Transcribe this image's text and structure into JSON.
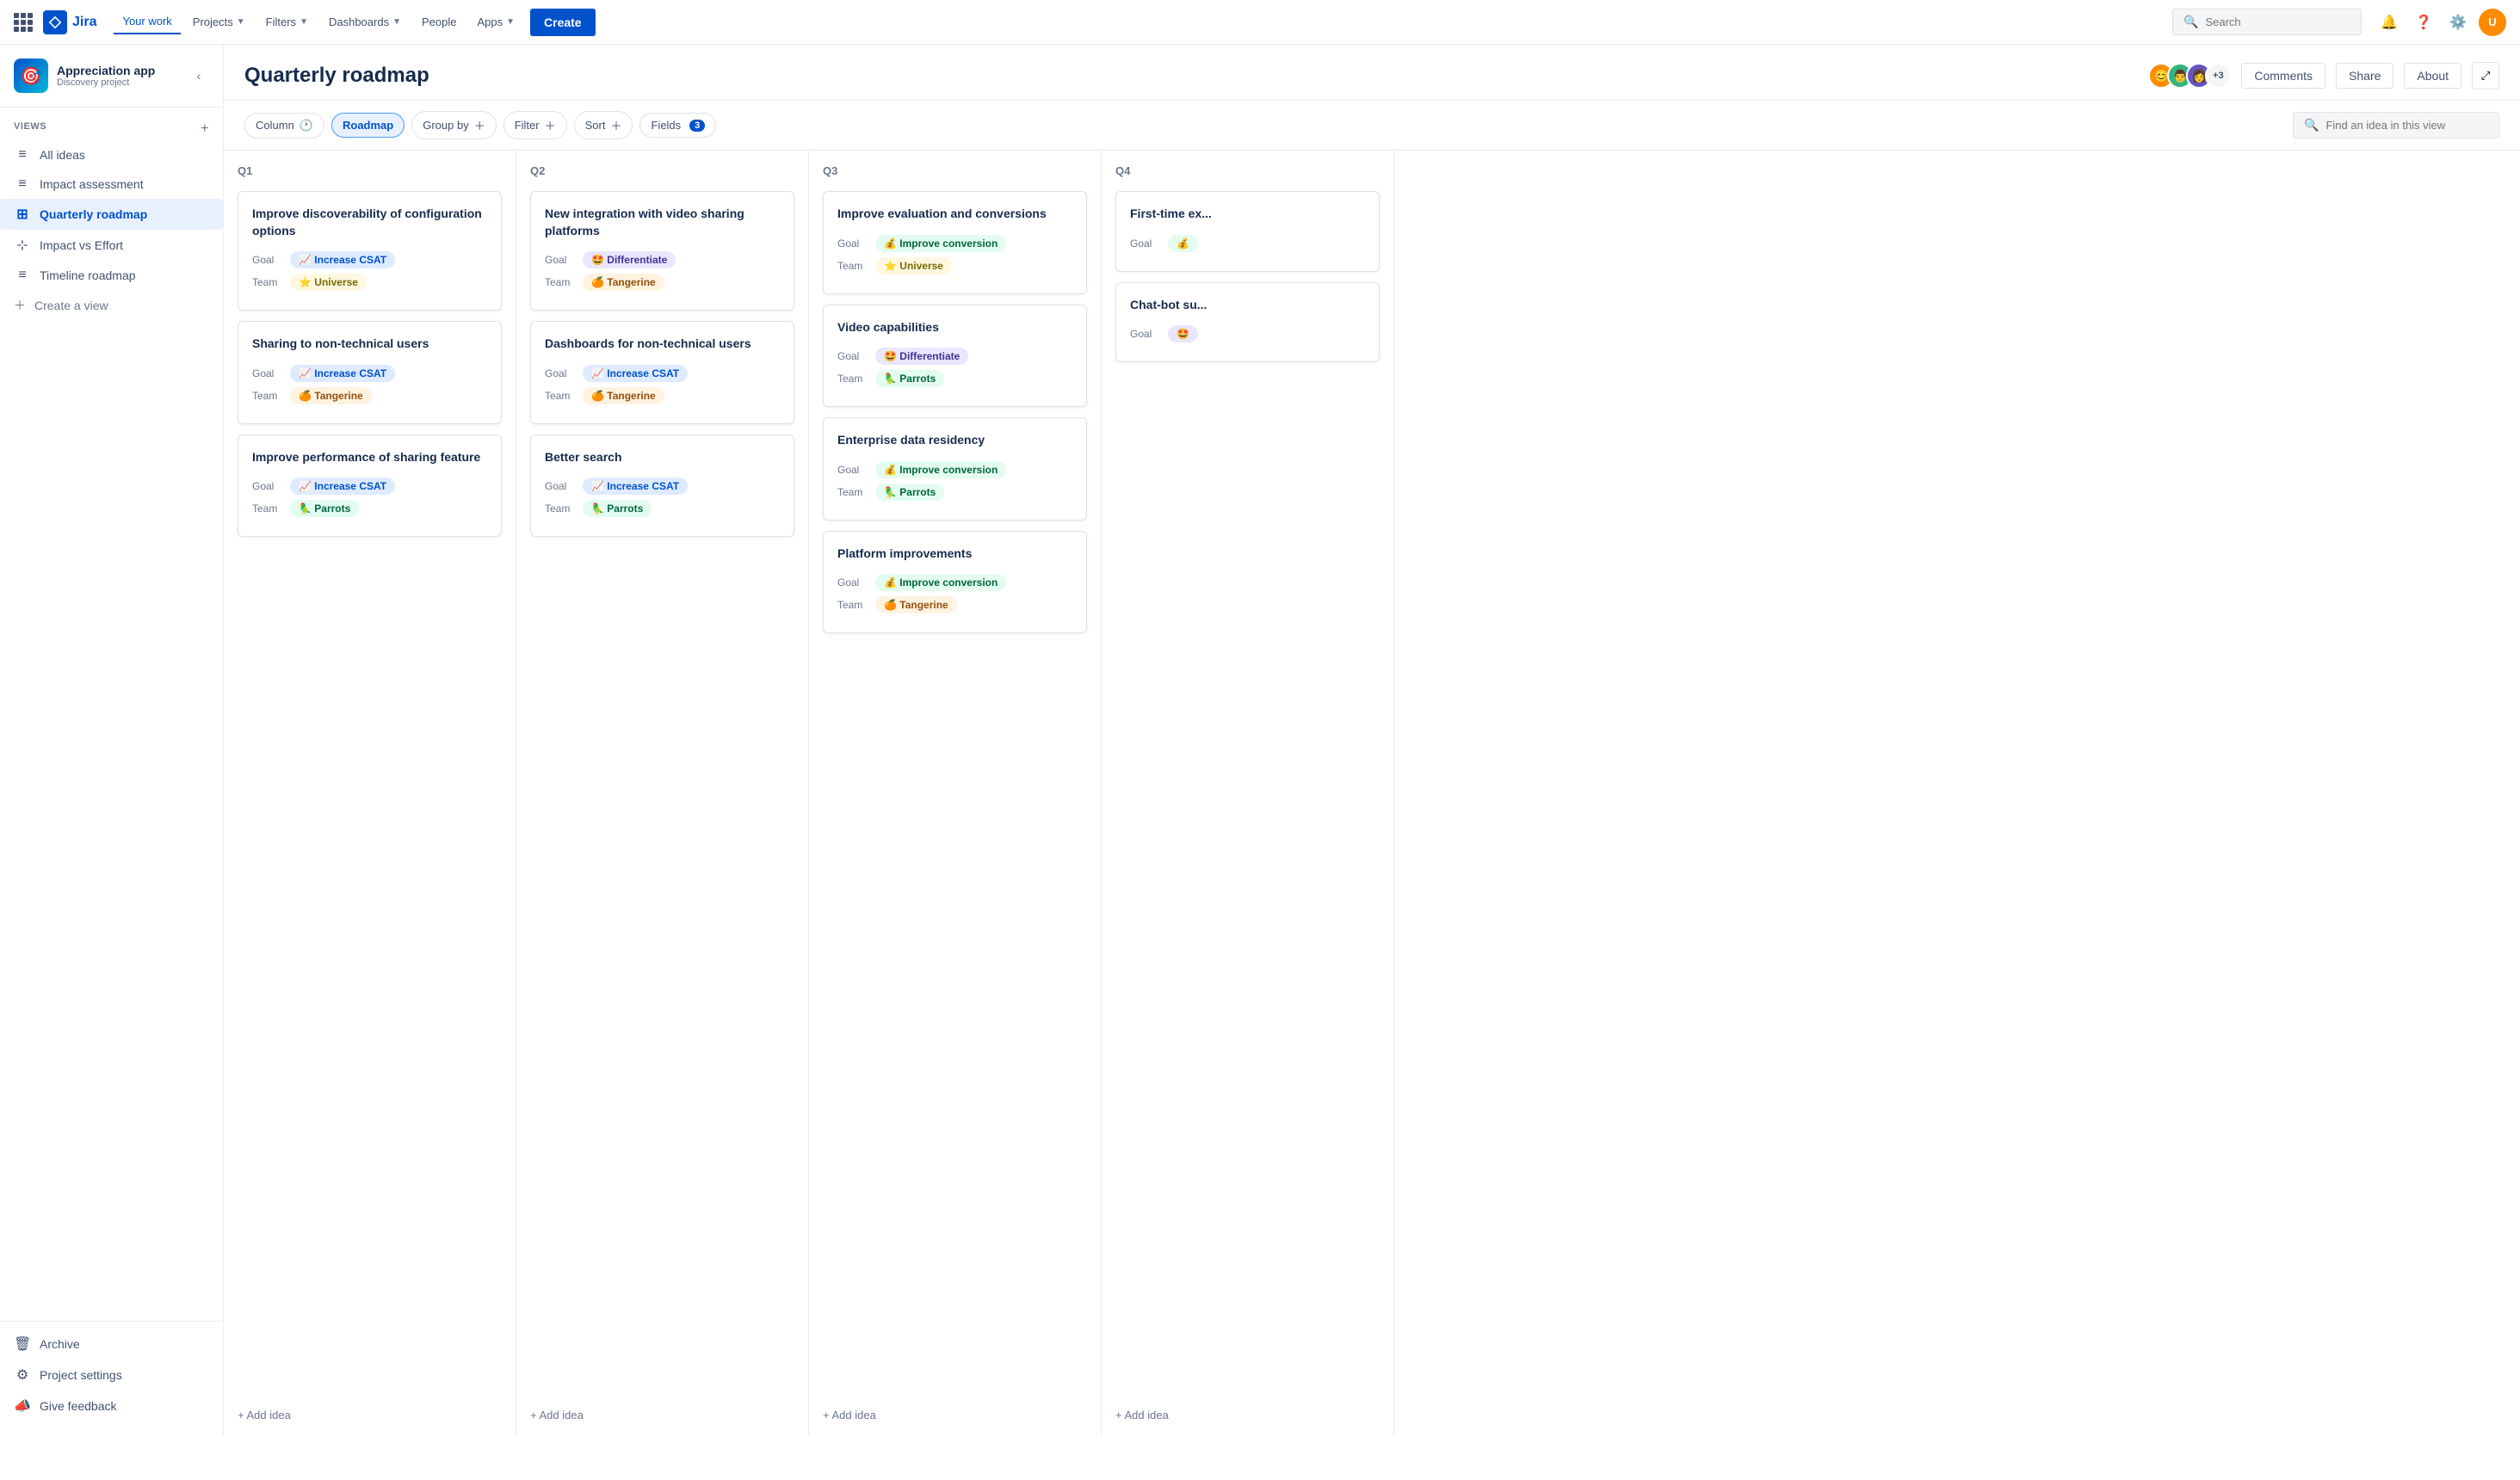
{
  "topnav": {
    "your_work": "Your work",
    "projects": "Projects",
    "filters": "Filters",
    "dashboards": "Dashboards",
    "people": "People",
    "apps": "Apps",
    "create": "Create",
    "search_placeholder": "Search"
  },
  "sidebar": {
    "project_icon": "🎯",
    "project_name": "Appreciation app",
    "project_type": "Discovery project",
    "views_label": "VIEWS",
    "add_view": "+",
    "items": [
      {
        "id": "all-ideas",
        "label": "All ideas",
        "icon": "≡",
        "active": false
      },
      {
        "id": "impact-assessment",
        "label": "Impact assessment",
        "icon": "≡",
        "active": false
      },
      {
        "id": "quarterly-roadmap",
        "label": "Quarterly roadmap",
        "icon": "⊞",
        "active": true
      },
      {
        "id": "impact-vs-effort",
        "label": "Impact vs Effort",
        "icon": "⊹",
        "active": false
      },
      {
        "id": "timeline-roadmap",
        "label": "Timeline roadmap",
        "icon": "≡",
        "active": false
      }
    ],
    "create_view": "Create a view",
    "bottom_items": [
      {
        "id": "archive",
        "label": "Archive",
        "icon": "🗑"
      },
      {
        "id": "project-settings",
        "label": "Project settings",
        "icon": "⚙"
      },
      {
        "id": "give-feedback",
        "label": "Give feedback",
        "icon": "📣"
      }
    ]
  },
  "main": {
    "title": "Quarterly roadmap",
    "header_buttons": {
      "comments": "Comments",
      "share": "Share",
      "about": "About"
    },
    "avatar_count": "+3",
    "toolbar": {
      "column": "Column",
      "roadmap": "Roadmap",
      "group_by": "Group by",
      "filter": "Filter",
      "sort": "Sort",
      "fields": "Fields",
      "fields_count": "3",
      "search_placeholder": "Find an idea in this view"
    },
    "columns": [
      {
        "id": "q1",
        "label": "Q1",
        "cards": [
          {
            "title": "Improve discoverability of configuration options",
            "goal_label": "Goal",
            "goal_emoji": "📈",
            "goal_text": "Increase CSAT",
            "goal_color": "blue",
            "team_label": "Team",
            "team_emoji": "⭐",
            "team_text": "Universe",
            "team_color": "yellow"
          },
          {
            "title": "Sharing to non-technical users",
            "goal_label": "Goal",
            "goal_emoji": "📈",
            "goal_text": "Increase CSAT",
            "goal_color": "blue",
            "team_label": "Team",
            "team_emoji": "🍊",
            "team_text": "Tangerine",
            "team_color": "orange"
          },
          {
            "title": "Improve performance of sharing feature",
            "goal_label": "Goal",
            "goal_emoji": "📈",
            "goal_text": "Increase CSAT",
            "goal_color": "blue",
            "team_label": "Team",
            "team_emoji": "🦜",
            "team_text": "Parrots",
            "team_color": "green"
          }
        ],
        "add_idea": "+ Add idea"
      },
      {
        "id": "q2",
        "label": "Q2",
        "cards": [
          {
            "title": "New integration with video sharing platforms",
            "goal_label": "Goal",
            "goal_emoji": "🤩",
            "goal_text": "Differentiate",
            "goal_color": "purple",
            "team_label": "Team",
            "team_emoji": "🍊",
            "team_text": "Tangerine",
            "team_color": "orange"
          },
          {
            "title": "Dashboards for non-technical users",
            "goal_label": "Goal",
            "goal_emoji": "📈",
            "goal_text": "Increase CSAT",
            "goal_color": "blue",
            "team_label": "Team",
            "team_emoji": "🍊",
            "team_text": "Tangerine",
            "team_color": "orange"
          },
          {
            "title": "Better search",
            "goal_label": "Goal",
            "goal_emoji": "📈",
            "goal_text": "Increase CSAT",
            "goal_color": "blue",
            "team_label": "Team",
            "team_emoji": "🦜",
            "team_text": "Parrots",
            "team_color": "green"
          }
        ],
        "add_idea": "+ Add idea"
      },
      {
        "id": "q3",
        "label": "Q3",
        "cards": [
          {
            "title": "Improve evaluation and conversions",
            "goal_label": "Goal",
            "goal_emoji": "💰",
            "goal_text": "Improve conversion",
            "goal_color": "teal",
            "team_label": "Team",
            "team_emoji": "⭐",
            "team_text": "Universe",
            "team_color": "yellow"
          },
          {
            "title": "Video capabilities",
            "goal_label": "Goal",
            "goal_emoji": "🤩",
            "goal_text": "Differentiate",
            "goal_color": "purple",
            "team_label": "Team",
            "team_emoji": "🦜",
            "team_text": "Parrots",
            "team_color": "green"
          },
          {
            "title": "Enterprise data residency",
            "goal_label": "Goal",
            "goal_emoji": "💰",
            "goal_text": "Improve conversion",
            "goal_color": "teal",
            "team_label": "Team",
            "team_emoji": "🦜",
            "team_text": "Parrots",
            "team_color": "green"
          },
          {
            "title": "Platform improvements",
            "goal_label": "Goal",
            "goal_emoji": "💰",
            "goal_text": "Improve conversion",
            "goal_color": "teal",
            "team_label": "Team",
            "team_emoji": "🍊",
            "team_text": "Tangerine",
            "team_color": "orange"
          }
        ],
        "add_idea": "+ Add idea"
      },
      {
        "id": "q4",
        "label": "Q4",
        "cards": [
          {
            "title": "First-time ex...",
            "goal_label": "Goal",
            "goal_emoji": "💰",
            "goal_text": "...",
            "goal_color": "teal",
            "team_label": "",
            "team_emoji": "",
            "team_text": "",
            "team_color": ""
          },
          {
            "title": "Chat-bot su...",
            "goal_label": "Goal",
            "goal_emoji": "🤩",
            "goal_text": "...",
            "goal_color": "purple",
            "team_label": "",
            "team_emoji": "",
            "team_text": "",
            "team_color": ""
          }
        ],
        "add_idea": "+ Add idea"
      }
    ]
  }
}
